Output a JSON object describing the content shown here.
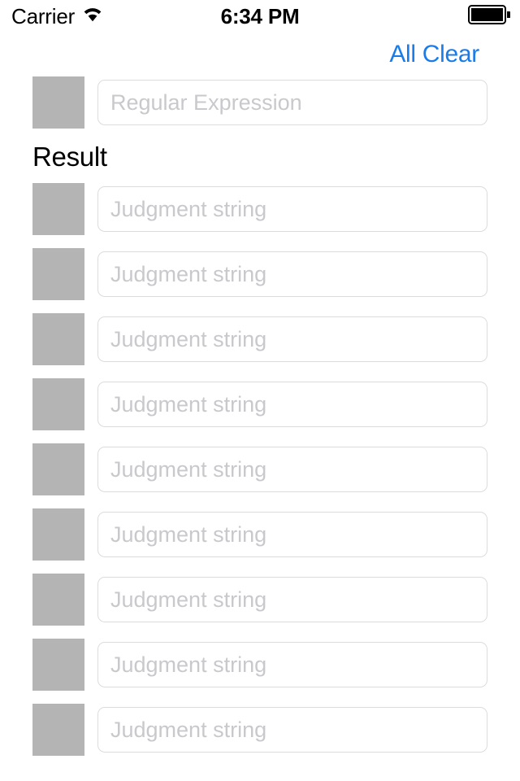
{
  "status_bar": {
    "carrier": "Carrier",
    "wifi_icon": "wifi-icon",
    "time": "6:34 PM",
    "battery_icon": "battery-full-icon"
  },
  "toolbar": {
    "all_clear_label": "All Clear",
    "accent_color": "#1a7ce8"
  },
  "regex_row": {
    "swatch_name": "regex-swatch",
    "swatch_color": "#b4b4b4",
    "placeholder": "Regular Expression",
    "value": ""
  },
  "result_heading": "Result",
  "judgment_rows": [
    {
      "swatch_color": "#b4b4b4",
      "placeholder": "Judgment string",
      "value": ""
    },
    {
      "swatch_color": "#b4b4b4",
      "placeholder": "Judgment string",
      "value": ""
    },
    {
      "swatch_color": "#b4b4b4",
      "placeholder": "Judgment string",
      "value": ""
    },
    {
      "swatch_color": "#b4b4b4",
      "placeholder": "Judgment string",
      "value": ""
    },
    {
      "swatch_color": "#b4b4b4",
      "placeholder": "Judgment string",
      "value": ""
    },
    {
      "swatch_color": "#b4b4b4",
      "placeholder": "Judgment string",
      "value": ""
    },
    {
      "swatch_color": "#b4b4b4",
      "placeholder": "Judgment string",
      "value": ""
    },
    {
      "swatch_color": "#b4b4b4",
      "placeholder": "Judgment string",
      "value": ""
    },
    {
      "swatch_color": "#b4b4b4",
      "placeholder": "Judgment string",
      "value": ""
    }
  ]
}
